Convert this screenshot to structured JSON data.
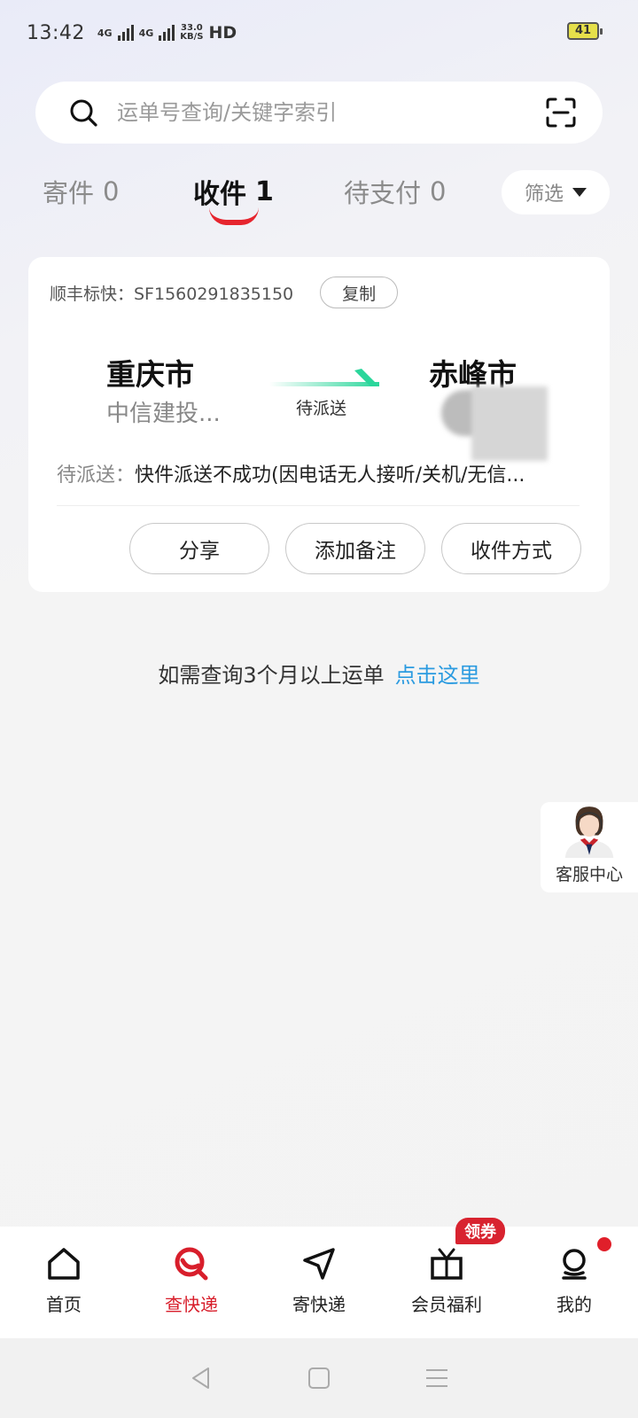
{
  "status_bar": {
    "time": "13:42",
    "network_1": "4G",
    "network_2": "4G",
    "speed_value": "33.0",
    "speed_unit": "KB/S",
    "hd": "HD",
    "battery": "41"
  },
  "search": {
    "placeholder": "运单号查询/关键字索引"
  },
  "tabs": [
    {
      "label": "寄件",
      "count": "0"
    },
    {
      "label": "收件",
      "count": "1"
    },
    {
      "label": "待支付",
      "count": "0"
    }
  ],
  "filter": {
    "label": "筛选"
  },
  "shipment": {
    "waybill": "顺丰标快：SF1560291835150",
    "copy_label": "复制",
    "origin_city": "重庆市",
    "origin_detail": "中信建投...",
    "destination_city": "赤峰市",
    "route_status": "待派送",
    "progress_label": "待派送：",
    "progress_text": "快件派送不成功(因电话无人接听/关机/无信...",
    "actions": {
      "share": "分享",
      "add_note": "添加备注",
      "receive_method": "收件方式"
    }
  },
  "history": {
    "text": "如需查询3个月以上运单",
    "link": "点击这里"
  },
  "customer_service": {
    "label": "客服中心"
  },
  "bottom_nav": [
    {
      "label": "首页",
      "icon": "home-icon"
    },
    {
      "label": "查快递",
      "icon": "track-package-icon"
    },
    {
      "label": "寄快递",
      "icon": "send-icon"
    },
    {
      "label": "会员福利",
      "icon": "gift-icon",
      "badge": "领券"
    },
    {
      "label": "我的",
      "icon": "profile-icon"
    }
  ],
  "colors": {
    "accent_red": "#e6252e",
    "link_blue": "#2b9be0",
    "route_green": "#2bd69b"
  }
}
